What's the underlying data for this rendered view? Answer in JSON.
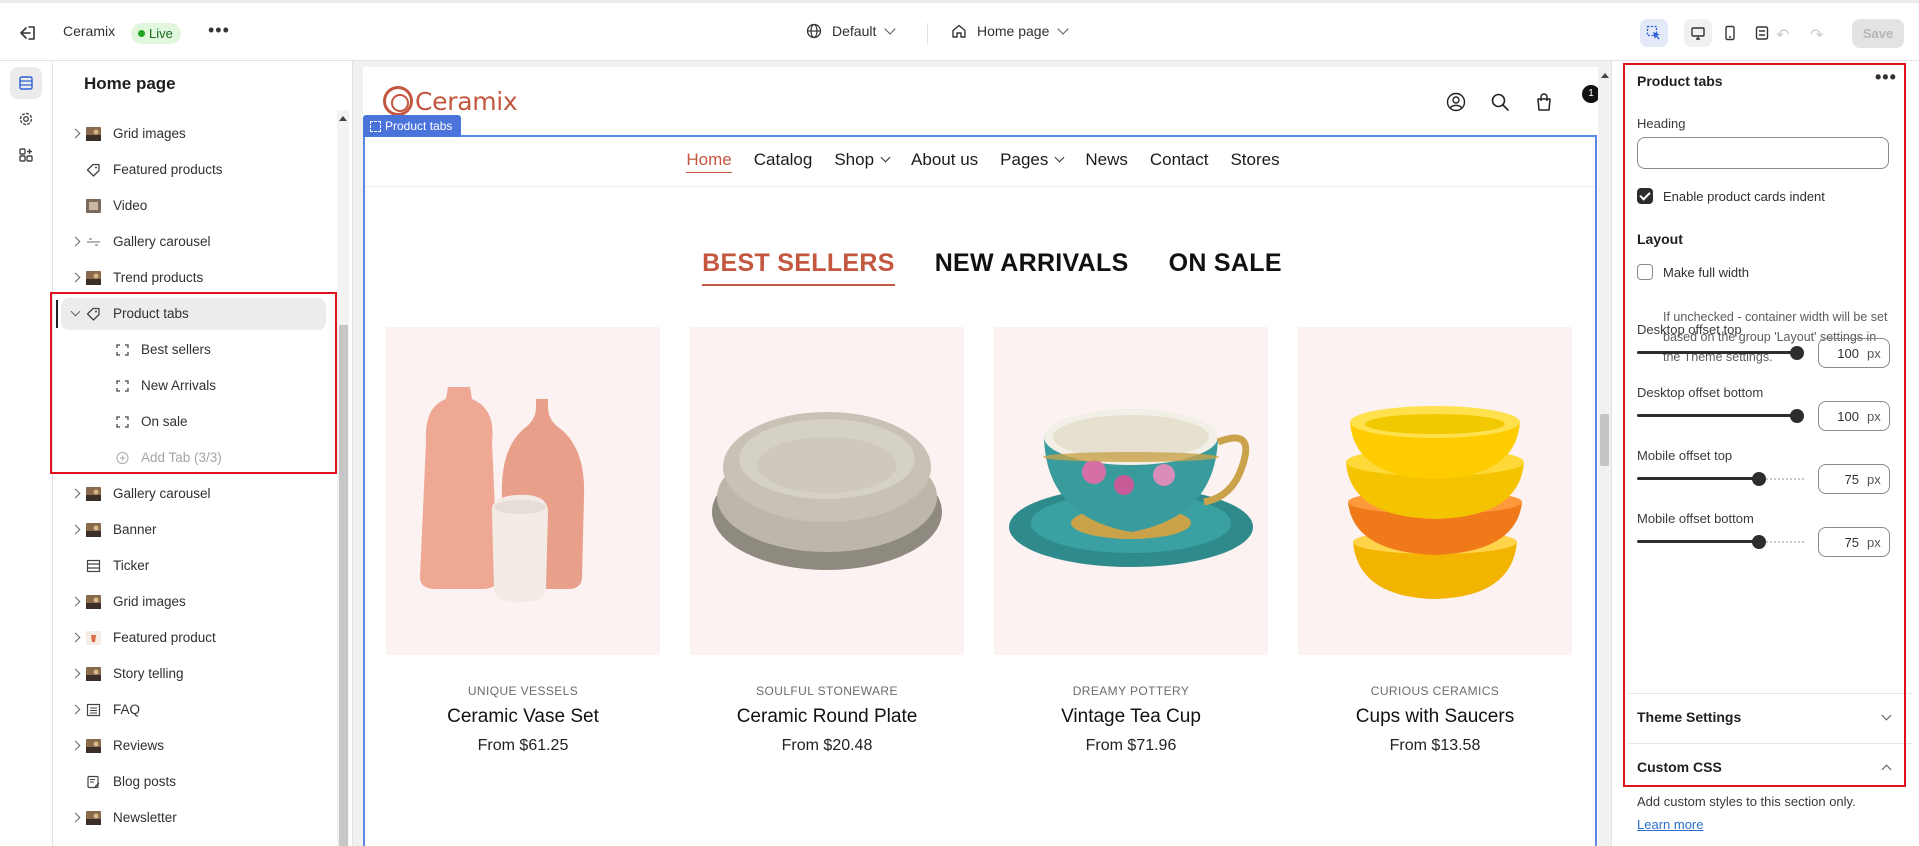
{
  "topbar": {
    "store_name": "Ceramix",
    "status": "Live",
    "theme": "Default",
    "page": "Home page",
    "save_label": "Save"
  },
  "sidebar": {
    "title": "Home page",
    "items": [
      {
        "label": "Grid images",
        "icon": "image-thumb-icon",
        "expandable": true
      },
      {
        "label": "Featured products",
        "icon": "tag-icon",
        "expandable": false
      },
      {
        "label": "Video",
        "icon": "video-thumb-icon",
        "expandable": false
      },
      {
        "label": "Gallery carousel",
        "icon": "gallery-icon",
        "expandable": true
      },
      {
        "label": "Trend products",
        "icon": "image-thumb-icon",
        "expandable": true
      },
      {
        "label": "Product tabs",
        "icon": "tag-icon",
        "expandable": true,
        "expanded": true,
        "selected": true
      },
      {
        "label": "Best sellers",
        "icon": "block-icon",
        "sub": true
      },
      {
        "label": "New Arrivals",
        "icon": "block-icon",
        "sub": true
      },
      {
        "label": "On sale",
        "icon": "block-icon",
        "sub": true
      },
      {
        "label": "Add Tab (3/3)",
        "icon": "plus-circle-icon",
        "sub": true,
        "disabled": true
      },
      {
        "label": "Gallery carousel",
        "icon": "image-thumb-icon",
        "expandable": true
      },
      {
        "label": "Banner",
        "icon": "image-thumb-icon",
        "expandable": true
      },
      {
        "label": "Ticker",
        "icon": "ticker-icon",
        "expandable": false
      },
      {
        "label": "Grid images",
        "icon": "image-thumb-icon",
        "expandable": true
      },
      {
        "label": "Featured product",
        "icon": "product-thumb-icon",
        "expandable": true
      },
      {
        "label": "Story telling",
        "icon": "image-thumb-icon",
        "expandable": true
      },
      {
        "label": "FAQ",
        "icon": "list-icon",
        "expandable": true
      },
      {
        "label": "Reviews",
        "icon": "image-thumb-icon",
        "expandable": true
      },
      {
        "label": "Blog posts",
        "icon": "blog-icon",
        "expandable": false
      },
      {
        "label": "Newsletter",
        "icon": "image-thumb-icon",
        "expandable": true
      }
    ]
  },
  "preview": {
    "logo": "Ceramix",
    "section_tag": "Product tabs",
    "cart_count": "1",
    "nav": [
      {
        "label": "Home",
        "active": true,
        "dropdown": false
      },
      {
        "label": "Catalog",
        "dropdown": false
      },
      {
        "label": "Shop",
        "dropdown": true
      },
      {
        "label": "About us",
        "dropdown": false
      },
      {
        "label": "Pages",
        "dropdown": true
      },
      {
        "label": "News",
        "dropdown": false
      },
      {
        "label": "Contact",
        "dropdown": false
      },
      {
        "label": "Stores",
        "dropdown": false
      }
    ],
    "tabs": [
      {
        "label": "BEST SELLERS",
        "active": true
      },
      {
        "label": "NEW ARRIVALS"
      },
      {
        "label": "ON SALE"
      }
    ],
    "products": [
      {
        "vendor": "UNIQUE VESSELS",
        "name": "Ceramic Vase Set",
        "price": "From $61.25"
      },
      {
        "vendor": "SOULFUL STONEWARE",
        "name": "Ceramic Round Plate",
        "price": "From $20.48"
      },
      {
        "vendor": "DREAMY POTTERY",
        "name": "Vintage Tea Cup",
        "price": "From $71.96"
      },
      {
        "vendor": "CURIOUS CERAMICS",
        "name": "Cups with Saucers",
        "price": "From $13.58"
      }
    ]
  },
  "panel": {
    "title": "Product tabs",
    "heading_label": "Heading",
    "heading_value": "",
    "indent_label": "Enable product cards indent",
    "indent_checked": true,
    "layout_heading": "Layout",
    "full_width_label": "Make full width",
    "full_width_checked": false,
    "full_width_help": "If unchecked - container width will be set based on the group 'Layout' settings in the Theme settings.",
    "sliders": [
      {
        "label": "Desktop offset top",
        "value": "100",
        "unit": "px",
        "fraction": 1.0
      },
      {
        "label": "Desktop offset bottom",
        "value": "100",
        "unit": "px",
        "fraction": 1.0
      },
      {
        "label": "Mobile offset top",
        "value": "75",
        "unit": "px",
        "fraction": 0.75
      },
      {
        "label": "Mobile offset bottom",
        "value": "75",
        "unit": "px",
        "fraction": 0.75
      }
    ],
    "theme_settings_label": "Theme Settings",
    "custom_css_label": "Custom CSS",
    "custom_css_help": "Add custom styles to this section only.",
    "learn_more": "Learn more"
  }
}
